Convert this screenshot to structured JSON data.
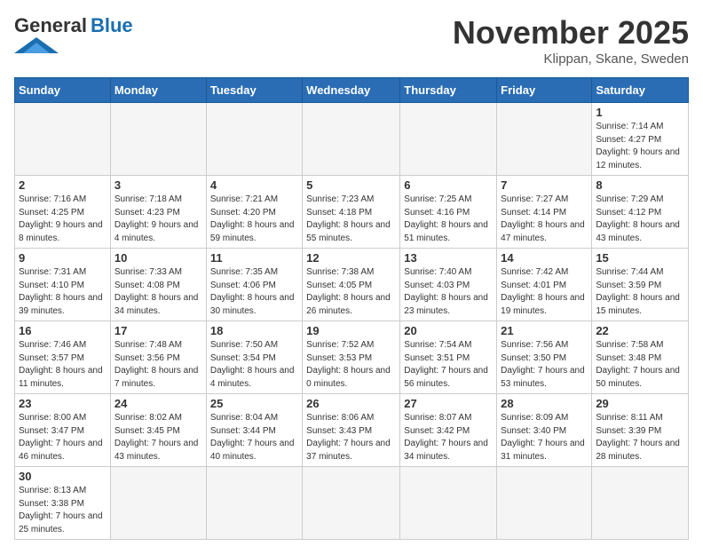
{
  "logo": {
    "general": "General",
    "blue": "Blue"
  },
  "title": "November 2025",
  "location": "Klippan, Skane, Sweden",
  "days_header": [
    "Sunday",
    "Monday",
    "Tuesday",
    "Wednesday",
    "Thursday",
    "Friday",
    "Saturday"
  ],
  "weeks": [
    [
      {
        "day": "",
        "info": ""
      },
      {
        "day": "",
        "info": ""
      },
      {
        "day": "",
        "info": ""
      },
      {
        "day": "",
        "info": ""
      },
      {
        "day": "",
        "info": ""
      },
      {
        "day": "",
        "info": ""
      },
      {
        "day": "1",
        "info": "Sunrise: 7:14 AM\nSunset: 4:27 PM\nDaylight: 9 hours and 12 minutes."
      }
    ],
    [
      {
        "day": "2",
        "info": "Sunrise: 7:16 AM\nSunset: 4:25 PM\nDaylight: 9 hours and 8 minutes."
      },
      {
        "day": "3",
        "info": "Sunrise: 7:18 AM\nSunset: 4:23 PM\nDaylight: 9 hours and 4 minutes."
      },
      {
        "day": "4",
        "info": "Sunrise: 7:21 AM\nSunset: 4:20 PM\nDaylight: 8 hours and 59 minutes."
      },
      {
        "day": "5",
        "info": "Sunrise: 7:23 AM\nSunset: 4:18 PM\nDaylight: 8 hours and 55 minutes."
      },
      {
        "day": "6",
        "info": "Sunrise: 7:25 AM\nSunset: 4:16 PM\nDaylight: 8 hours and 51 minutes."
      },
      {
        "day": "7",
        "info": "Sunrise: 7:27 AM\nSunset: 4:14 PM\nDaylight: 8 hours and 47 minutes."
      },
      {
        "day": "8",
        "info": "Sunrise: 7:29 AM\nSunset: 4:12 PM\nDaylight: 8 hours and 43 minutes."
      }
    ],
    [
      {
        "day": "9",
        "info": "Sunrise: 7:31 AM\nSunset: 4:10 PM\nDaylight: 8 hours and 39 minutes."
      },
      {
        "day": "10",
        "info": "Sunrise: 7:33 AM\nSunset: 4:08 PM\nDaylight: 8 hours and 34 minutes."
      },
      {
        "day": "11",
        "info": "Sunrise: 7:35 AM\nSunset: 4:06 PM\nDaylight: 8 hours and 30 minutes."
      },
      {
        "day": "12",
        "info": "Sunrise: 7:38 AM\nSunset: 4:05 PM\nDaylight: 8 hours and 26 minutes."
      },
      {
        "day": "13",
        "info": "Sunrise: 7:40 AM\nSunset: 4:03 PM\nDaylight: 8 hours and 23 minutes."
      },
      {
        "day": "14",
        "info": "Sunrise: 7:42 AM\nSunset: 4:01 PM\nDaylight: 8 hours and 19 minutes."
      },
      {
        "day": "15",
        "info": "Sunrise: 7:44 AM\nSunset: 3:59 PM\nDaylight: 8 hours and 15 minutes."
      }
    ],
    [
      {
        "day": "16",
        "info": "Sunrise: 7:46 AM\nSunset: 3:57 PM\nDaylight: 8 hours and 11 minutes."
      },
      {
        "day": "17",
        "info": "Sunrise: 7:48 AM\nSunset: 3:56 PM\nDaylight: 8 hours and 7 minutes."
      },
      {
        "day": "18",
        "info": "Sunrise: 7:50 AM\nSunset: 3:54 PM\nDaylight: 8 hours and 4 minutes."
      },
      {
        "day": "19",
        "info": "Sunrise: 7:52 AM\nSunset: 3:53 PM\nDaylight: 8 hours and 0 minutes."
      },
      {
        "day": "20",
        "info": "Sunrise: 7:54 AM\nSunset: 3:51 PM\nDaylight: 7 hours and 56 minutes."
      },
      {
        "day": "21",
        "info": "Sunrise: 7:56 AM\nSunset: 3:50 PM\nDaylight: 7 hours and 53 minutes."
      },
      {
        "day": "22",
        "info": "Sunrise: 7:58 AM\nSunset: 3:48 PM\nDaylight: 7 hours and 50 minutes."
      }
    ],
    [
      {
        "day": "23",
        "info": "Sunrise: 8:00 AM\nSunset: 3:47 PM\nDaylight: 7 hours and 46 minutes."
      },
      {
        "day": "24",
        "info": "Sunrise: 8:02 AM\nSunset: 3:45 PM\nDaylight: 7 hours and 43 minutes."
      },
      {
        "day": "25",
        "info": "Sunrise: 8:04 AM\nSunset: 3:44 PM\nDaylight: 7 hours and 40 minutes."
      },
      {
        "day": "26",
        "info": "Sunrise: 8:06 AM\nSunset: 3:43 PM\nDaylight: 7 hours and 37 minutes."
      },
      {
        "day": "27",
        "info": "Sunrise: 8:07 AM\nSunset: 3:42 PM\nDaylight: 7 hours and 34 minutes."
      },
      {
        "day": "28",
        "info": "Sunrise: 8:09 AM\nSunset: 3:40 PM\nDaylight: 7 hours and 31 minutes."
      },
      {
        "day": "29",
        "info": "Sunrise: 8:11 AM\nSunset: 3:39 PM\nDaylight: 7 hours and 28 minutes."
      }
    ],
    [
      {
        "day": "30",
        "info": "Sunrise: 8:13 AM\nSunset: 3:38 PM\nDaylight: 7 hours and 25 minutes."
      },
      {
        "day": "",
        "info": ""
      },
      {
        "day": "",
        "info": ""
      },
      {
        "day": "",
        "info": ""
      },
      {
        "day": "",
        "info": ""
      },
      {
        "day": "",
        "info": ""
      },
      {
        "day": "",
        "info": ""
      }
    ]
  ]
}
